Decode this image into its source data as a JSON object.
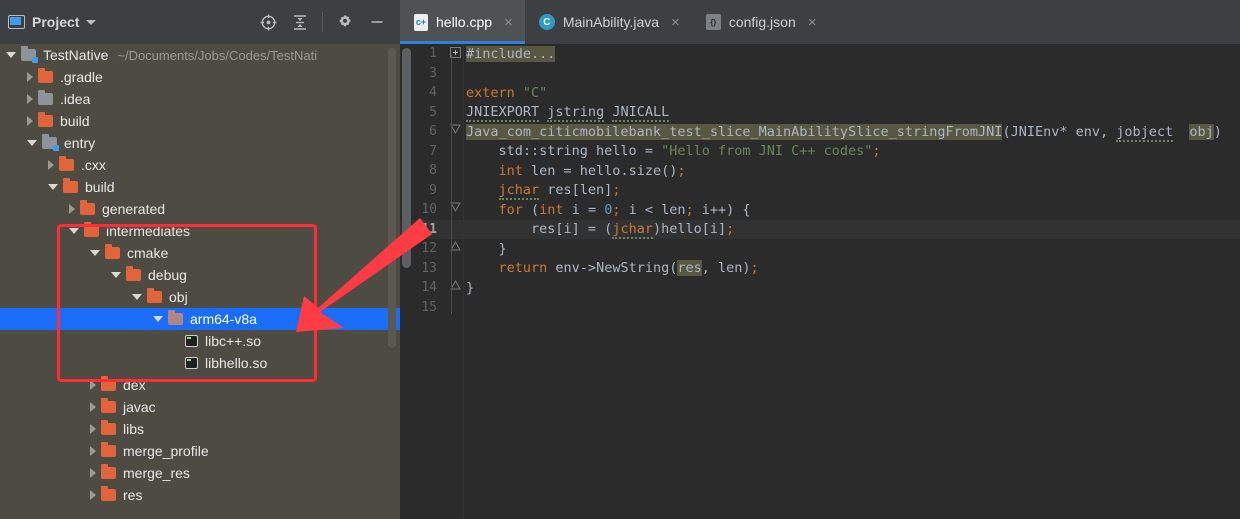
{
  "sidebar": {
    "panel_title": "Project",
    "toolbar_icons": [
      {
        "name": "locate-target-icon",
        "glyph": "target"
      },
      {
        "name": "collapse-all-icon",
        "glyph": "collapse"
      },
      {
        "name": "settings-gear-icon",
        "glyph": "gear"
      },
      {
        "name": "minimize-icon",
        "glyph": "minus"
      }
    ],
    "tree": [
      {
        "label": "TestNative",
        "path": "~/Documents/Jobs/Codes/TestNati",
        "indent": 0,
        "arrow": "open",
        "icon": "module",
        "selected": false
      },
      {
        "label": ".gradle",
        "path": "",
        "indent": 1,
        "arrow": "closed",
        "icon": "folder",
        "selected": false
      },
      {
        "label": ".idea",
        "path": "",
        "indent": 1,
        "arrow": "closed",
        "icon": "gray",
        "selected": false
      },
      {
        "label": "build",
        "path": "",
        "indent": 1,
        "arrow": "closed",
        "icon": "folder",
        "selected": false
      },
      {
        "label": "entry",
        "path": "",
        "indent": 1,
        "arrow": "open",
        "icon": "module",
        "selected": false
      },
      {
        "label": ".cxx",
        "path": "",
        "indent": 2,
        "arrow": "closed",
        "icon": "folder",
        "selected": false
      },
      {
        "label": "build",
        "path": "",
        "indent": 2,
        "arrow": "open",
        "icon": "folder",
        "selected": false
      },
      {
        "label": "generated",
        "path": "",
        "indent": 3,
        "arrow": "closed",
        "icon": "folder",
        "selected": false
      },
      {
        "label": "intermediates",
        "path": "",
        "indent": 3,
        "arrow": "open",
        "icon": "folder",
        "selected": false
      },
      {
        "label": "cmake",
        "path": "",
        "indent": 4,
        "arrow": "open",
        "icon": "folder",
        "selected": false
      },
      {
        "label": "debug",
        "path": "",
        "indent": 5,
        "arrow": "open",
        "icon": "folder",
        "selected": false
      },
      {
        "label": "obj",
        "path": "",
        "indent": 6,
        "arrow": "open",
        "icon": "folder",
        "selected": false
      },
      {
        "label": "arm64-v8a",
        "path": "",
        "indent": 7,
        "arrow": "open",
        "icon": "muted",
        "selected": true
      },
      {
        "label": "libc++.so",
        "path": "",
        "indent": 8,
        "arrow": "none",
        "icon": "so",
        "selected": false
      },
      {
        "label": "libhello.so",
        "path": "",
        "indent": 8,
        "arrow": "none",
        "icon": "so",
        "selected": false
      },
      {
        "label": "dex",
        "path": "",
        "indent": 4,
        "arrow": "closed",
        "icon": "folder",
        "selected": false
      },
      {
        "label": "javac",
        "path": "",
        "indent": 4,
        "arrow": "closed",
        "icon": "folder",
        "selected": false
      },
      {
        "label": "libs",
        "path": "",
        "indent": 4,
        "arrow": "closed",
        "icon": "folder",
        "selected": false
      },
      {
        "label": "merge_profile",
        "path": "",
        "indent": 4,
        "arrow": "closed",
        "icon": "folder",
        "selected": false
      },
      {
        "label": "merge_res",
        "path": "",
        "indent": 4,
        "arrow": "closed",
        "icon": "folder",
        "selected": false
      },
      {
        "label": "res",
        "path": "",
        "indent": 4,
        "arrow": "closed",
        "icon": "folder",
        "selected": false
      }
    ]
  },
  "editor": {
    "tabs": [
      {
        "label": "hello.cpp",
        "icon": "cpp-file-icon",
        "active": true,
        "close": "×"
      },
      {
        "label": "MainAbility.java",
        "icon": "java-file-icon",
        "active": false,
        "close": "×"
      },
      {
        "label": "config.json",
        "icon": "json-file-icon",
        "active": false,
        "close": "×"
      }
    ],
    "lines": [
      {
        "num": "1",
        "fold": "+",
        "current": false
      },
      {
        "num": "3",
        "fold": "",
        "current": false
      },
      {
        "num": "4",
        "fold": "",
        "current": false
      },
      {
        "num": "5",
        "fold": "",
        "current": false
      },
      {
        "num": "6",
        "fold": "v",
        "current": false
      },
      {
        "num": "7",
        "fold": "",
        "current": false
      },
      {
        "num": "8",
        "fold": "",
        "current": false
      },
      {
        "num": "9",
        "fold": "",
        "current": false
      },
      {
        "num": "10",
        "fold": "v",
        "current": false
      },
      {
        "num": "11",
        "fold": "",
        "current": true
      },
      {
        "num": "12",
        "fold": "^",
        "current": false
      },
      {
        "num": "13",
        "fold": "",
        "current": false
      },
      {
        "num": "14",
        "fold": "^",
        "current": false
      },
      {
        "num": "15",
        "fold": "",
        "current": false
      }
    ],
    "code_text": [
      "#include...",
      "",
      "extern \"C\"",
      "JNIEXPORT jstring JNICALL",
      "Java_com_citicmobilebank_test_slice_MainAbilitySlice_stringFromJNI(JNIEnv* env, jobject  obj)",
      "    std::string hello = \"Hello from JNI C++ codes\";",
      "    int len = hello.size();",
      "    jchar res[len];",
      "    for (int i = 0; i < len; i++) {",
      "        res[i] = (jchar)hello[i];",
      "    }",
      "    return env->NewString(res, len);",
      "}",
      ""
    ]
  },
  "annotation": {
    "highlight_box_color": "#ff2b36",
    "arrow_color": "#ff3b44",
    "arrow_from": "editor gutter line 10",
    "arrow_to": "arm64-v8a folder row"
  },
  "colors": {
    "selection_blue": "#1a6dfa",
    "tab_underline": "#2f7fe0",
    "sidebar_bg": "#4e4b42",
    "editor_bg": "#2b2b2b",
    "toolbar_bg": "#3c4043",
    "keyword_orange": "#cc7832",
    "string_green": "#6a8759",
    "number_blue": "#6897bb",
    "usage_highlight": "#585741"
  }
}
